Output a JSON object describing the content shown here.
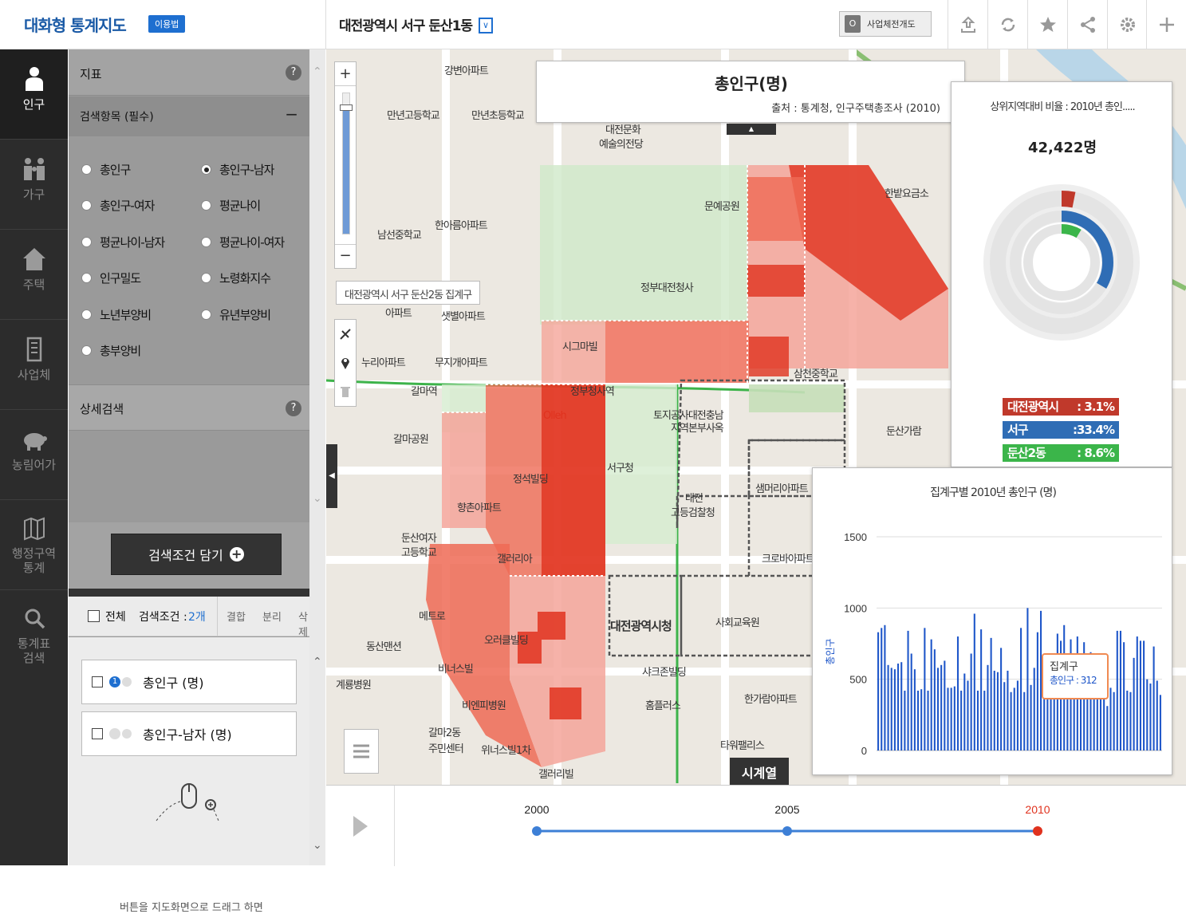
{
  "header": {
    "logo": "대화형 통계지도",
    "usage_label": "이용법",
    "location": "대전광역시 서구 둔산1동",
    "location_dropdown": "∨",
    "biz_toggle_value": "O",
    "biz_label": "사업체전개도"
  },
  "toolbar_icons": [
    "upload-icon",
    "refresh-icon",
    "star-icon",
    "share-icon",
    "settings-icon",
    "plus-icon"
  ],
  "nav": [
    {
      "label": "인구",
      "icon": "person-icon",
      "active": true
    },
    {
      "label": "가구",
      "icon": "family-icon",
      "active": false
    },
    {
      "label": "주택",
      "icon": "house-icon",
      "active": false
    },
    {
      "label": "사업체",
      "icon": "building-icon",
      "active": false
    },
    {
      "label": "농림어가",
      "icon": "pig-icon",
      "active": false
    },
    {
      "label": "행정구역 통계",
      "icon": "map-icon",
      "active": false
    },
    {
      "label": "통계표 검색",
      "icon": "search-icon",
      "active": false
    }
  ],
  "panel": {
    "indicator_title": "지표",
    "search_items_title": "검색항목 (필수)",
    "collapse": "−",
    "options": [
      {
        "label": "총인구",
        "selected": false
      },
      {
        "label": "총인구-남자",
        "selected": true
      },
      {
        "label": "총인구-여자",
        "selected": false
      },
      {
        "label": "평균나이",
        "selected": false
      },
      {
        "label": "평균나이-남자",
        "selected": false
      },
      {
        "label": "평균나이-여자",
        "selected": false
      },
      {
        "label": "인구밀도",
        "selected": false
      },
      {
        "label": "노령화지수",
        "selected": false
      },
      {
        "label": "노년부양비",
        "selected": false
      },
      {
        "label": "유년부양비",
        "selected": false
      },
      {
        "label": "총부양비",
        "selected": false
      }
    ],
    "detail_search": "상세검색",
    "add_condition_button": "검색조건 담기",
    "select_all": "전체",
    "condition_count_label": "검색조건 :",
    "condition_count": "2개",
    "combine": "결합",
    "split": "분리",
    "delete": "삭제",
    "conditions": [
      {
        "label": "총인구 (명)",
        "badge": "1"
      },
      {
        "label": "총인구-남자 (명)",
        "badge": ""
      }
    ],
    "drag_hint": "버튼을 지도화면으로 드래그 하면"
  },
  "map": {
    "title": "총인구(명)",
    "source": "출처 : 통계청, 인구주택총조사 (2010)",
    "tooltip": "대전광역시 서구 둔산2동 집계구",
    "zoom_in": "+",
    "zoom_out": "−",
    "zoom_level_fraction": 0.9,
    "colors": {
      "dark": "#e0321e",
      "mid": "#ef6a55",
      "light": "#f5a59a",
      "pale": "#f8cdc6",
      "green": "#cfe8c9"
    },
    "labels": [
      "강변아파트",
      "만년고등학교",
      "만년초등학교",
      "대전문화",
      "예술의전당",
      "문예공원",
      "한밭요금소",
      "남선중학교",
      "한아름아파트",
      "정부대전청사",
      "아파트",
      "샛별아파트",
      "누리아파트",
      "무지개아파트",
      "시그마빌",
      "삼천중학교",
      "정부청사역",
      "갈마역",
      "토지공사대전충남",
      "지역본부사옥",
      "둔산가람",
      "갈마공원",
      "정석빌딩",
      "서구청",
      "대전",
      "고등검찰청",
      "둔산여자",
      "고등학교",
      "갤러리아",
      "대전광역시청",
      "사회교육원",
      "동산맨션",
      "비너스빌",
      "샤크존빌딩",
      "계룡병원",
      "비엔피병원",
      "홈플러스",
      "한가람아파트",
      "갈마2동",
      "주민센터",
      "위너스빌1차",
      "갤러리빌",
      "타워팰리스",
      "오러클빌딩",
      "Olleh",
      "샘머리아파트",
      "향촌아파트",
      "크로바아파트",
      "메트로"
    ]
  },
  "donut_panel": {
    "title": "상위지역대비 비율 : 2010년 총인.....",
    "value": "42,422명",
    "legend": [
      {
        "label": "대전광역시",
        "value": ": 3.1%",
        "color": "#c0392b",
        "fraction": 0.031
      },
      {
        "label": "서구",
        "value": ":33.4%",
        "color": "#2f6db5",
        "fraction": 0.334
      },
      {
        "label": "둔산2동",
        "value": ": 8.6%",
        "color": "#3bb54a",
        "fraction": 0.086
      }
    ]
  },
  "bar_panel": {
    "title": "집계구별 2010년 총인구 (명)",
    "ylabel": "총인구",
    "tooltip_title": "집계구",
    "tooltip_value": "총인구 : 312"
  },
  "chart_data": {
    "type": "bar",
    "title": "집계구별 2010년 총인구 (명)",
    "ylabel": "총인구",
    "ylim": [
      0,
      1500
    ],
    "yticks": [
      0,
      500,
      1000,
      1500
    ],
    "values": [
      830,
      860,
      880,
      600,
      580,
      570,
      610,
      620,
      420,
      840,
      680,
      570,
      420,
      430,
      860,
      420,
      780,
      710,
      580,
      600,
      630,
      440,
      440,
      450,
      800,
      420,
      540,
      490,
      680,
      960,
      420,
      850,
      420,
      600,
      790,
      560,
      550,
      720,
      480,
      560,
      410,
      440,
      490,
      860,
      410,
      1000,
      460,
      580,
      830,
      980,
      560,
      500,
      480,
      470,
      820,
      770,
      880,
      450,
      780,
      600,
      800,
      600,
      760,
      660,
      690,
      470,
      430,
      410,
      500,
      312,
      440,
      410,
      840,
      840,
      760,
      420,
      410,
      650,
      800,
      770,
      770,
      500,
      470,
      730,
      490,
      390
    ]
  },
  "timeline": {
    "years": [
      "2000",
      "2005",
      "2010"
    ],
    "selected": "2010",
    "play": "▶",
    "timeseries_tab": "시계열"
  }
}
